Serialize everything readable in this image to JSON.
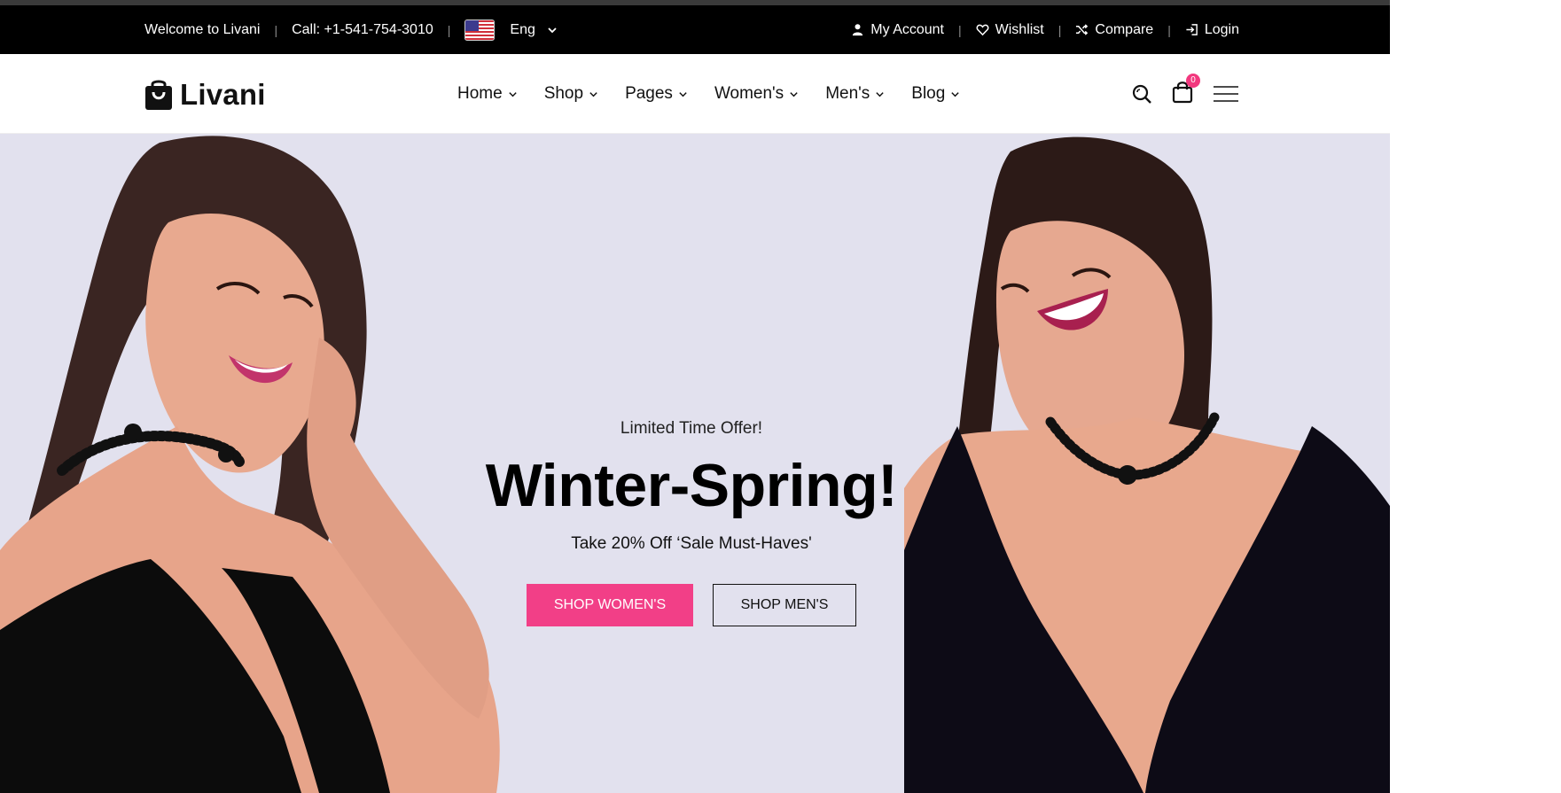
{
  "topbar": {
    "welcome": "Welcome to Livani",
    "call": "Call: +1-541-754-3010",
    "language": "Eng",
    "my_account": "My Account",
    "wishlist": "Wishlist",
    "compare": "Compare",
    "login": "Login"
  },
  "header": {
    "logo": "Livani",
    "nav": [
      {
        "label": "Home"
      },
      {
        "label": "Shop"
      },
      {
        "label": "Pages"
      },
      {
        "label": "Women's"
      },
      {
        "label": "Men's"
      },
      {
        "label": "Blog"
      }
    ],
    "cart_count": "0"
  },
  "hero": {
    "offer": "Limited Time Offer!",
    "headline": "Winter-Spring!",
    "subtext": "Take 20% Off ‘Sale Must-Haves'",
    "primary_button": "SHOP WOMEN'S",
    "secondary_button": "SHOP MEN'S"
  },
  "colors": {
    "accent": "#f23f87",
    "hero_background": "#e2e1ee",
    "topbar_background": "#000000"
  },
  "icons": [
    "user-icon",
    "heart-icon",
    "shuffle-icon",
    "login-icon",
    "search-icon",
    "cart-icon",
    "hamburger-icon",
    "chevron-down-icon",
    "flag-us-icon"
  ]
}
